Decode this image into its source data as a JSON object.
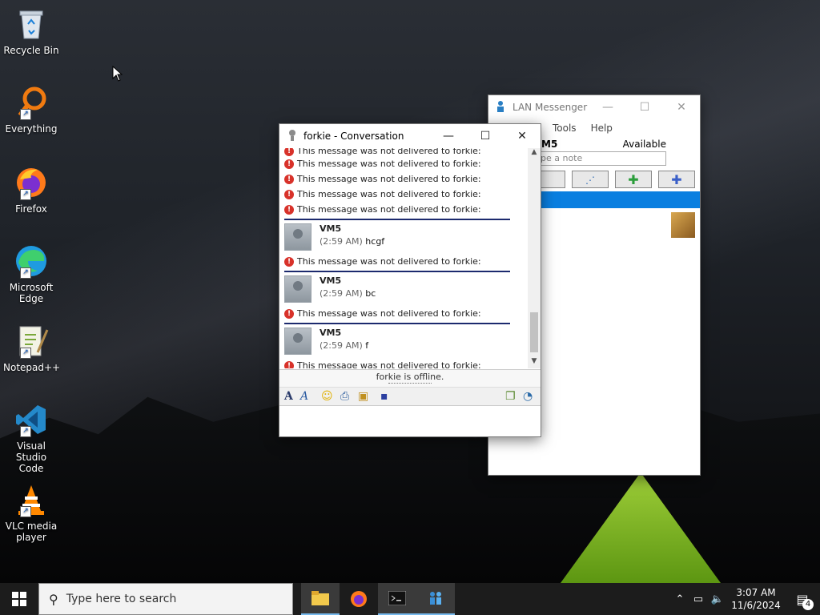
{
  "desktop": {
    "icons": [
      {
        "label": "Recycle Bin",
        "icon": "recycle-bin-icon"
      },
      {
        "label": "Everything",
        "icon": "everything-search-icon"
      },
      {
        "label": "Firefox",
        "icon": "firefox-icon"
      },
      {
        "label": "Microsoft Edge",
        "icon": "edge-icon"
      },
      {
        "label": "Notepad++",
        "icon": "notepadpp-icon"
      },
      {
        "label": "Visual Studio Code",
        "icon": "vscode-icon"
      },
      {
        "label": "VLC media player",
        "icon": "vlc-icon"
      }
    ]
  },
  "lan_window": {
    "title": "LAN Messenger",
    "menu": [
      "Tools",
      "Help"
    ],
    "user_name": "M5",
    "status": "Available",
    "note_placeholder": "pe a note",
    "accent": "#0a7fe0"
  },
  "conv_window": {
    "title": "forkie - Conversation",
    "error_text": "This message was not delivered to forkie:",
    "messages": [
      {
        "name": "VM5",
        "time": "(2:59 AM)",
        "text": "hcgf"
      },
      {
        "name": "VM5",
        "time": "(2:59 AM)",
        "text": "bc"
      },
      {
        "name": "VM5",
        "time": "(2:59 AM)",
        "text": "f"
      }
    ],
    "status_line": "forkie is offline.",
    "sep_color": "#1c2a6e",
    "error_color": "#d8322a"
  },
  "taskbar": {
    "search_placeholder": "Type here to search",
    "time": "3:07 AM",
    "date": "11/6/2024",
    "notification_count": "4"
  }
}
